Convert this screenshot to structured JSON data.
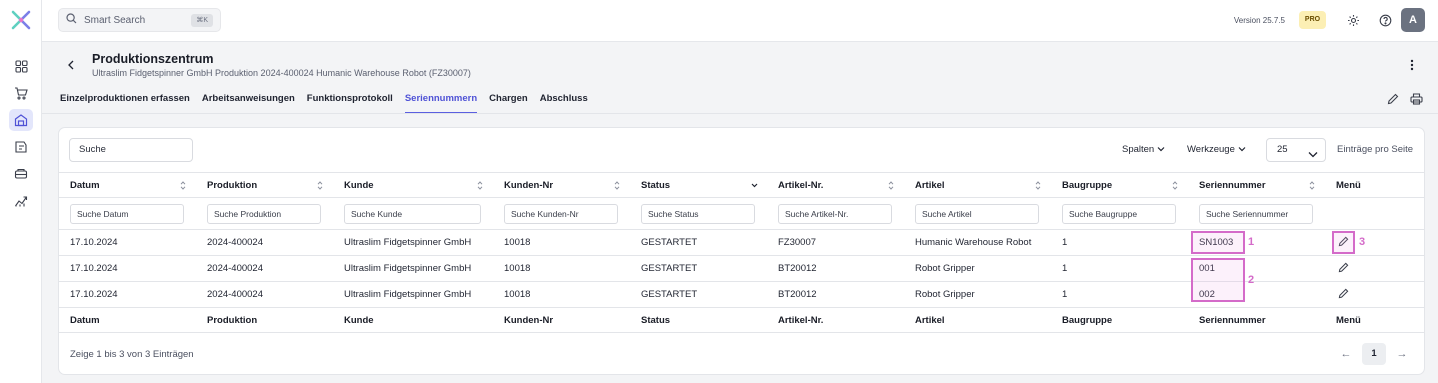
{
  "topbar": {
    "search_placeholder": "Smart Search",
    "search_shortcut": "⌘K",
    "version": "Version 25.7.5",
    "plan_badge": "PRO",
    "avatar_initial": "A"
  },
  "rail": {
    "items": [
      "dashboard-icon",
      "cart-icon",
      "warehouse-icon",
      "purchase-icon",
      "production-icon",
      "analytics-icon"
    ],
    "active_item": "warehouse-icon"
  },
  "page": {
    "title": "Produktionszentrum",
    "subtitle": "Ultraslim Fidgetspinner GmbH Produktion 2024-400024 Humanic Warehouse Robot (FZ30007)"
  },
  "tabs": [
    {
      "label": "Einzelproduktionen erfassen",
      "active": false
    },
    {
      "label": "Arbeitsanweisungen",
      "active": false
    },
    {
      "label": "Funktionsprotokoll",
      "active": false
    },
    {
      "label": "Seriennummern",
      "active": true
    },
    {
      "label": "Chargen",
      "active": false
    },
    {
      "label": "Abschluss",
      "active": false
    }
  ],
  "toolbar": {
    "search_value": "Suche",
    "columns_label": "Spalten",
    "tools_label": "Werkzeuge",
    "page_size": "25",
    "per_page_label": "Einträge pro Seite"
  },
  "table": {
    "columns": [
      "Datum",
      "Produktion",
      "Kunde",
      "Kunden-Nr",
      "Status",
      "Artikel-Nr.",
      "Artikel",
      "Baugruppe",
      "Seriennummer",
      "Menü"
    ],
    "filters": [
      "Suche Datum",
      "Suche Produktion",
      "Suche Kunde",
      "Suche Kunden-Nr",
      "Suche Status",
      "Suche Artikel-Nr.",
      "Suche Artikel",
      "Suche Baugruppe",
      "Suche Seriennummer"
    ],
    "rows": [
      [
        "17.10.2024",
        "2024-400024",
        "Ultraslim Fidgetspinner GmbH",
        "10018",
        "GESTARTET",
        "FZ30007",
        "Humanic Warehouse Robot",
        "1",
        "SN1003"
      ],
      [
        "17.10.2024",
        "2024-400024",
        "Ultraslim Fidgetspinner GmbH",
        "10018",
        "GESTARTET",
        "BT20012",
        "Robot Gripper",
        "1",
        "001"
      ],
      [
        "17.10.2024",
        "2024-400024",
        "Ultraslim Fidgetspinner GmbH",
        "10018",
        "GESTARTET",
        "BT20012",
        "Robot Gripper",
        "1",
        "002"
      ]
    ]
  },
  "annotations": {
    "mark1": "1",
    "mark2": "2",
    "mark3": "3",
    "color": "#d46bc9"
  },
  "footer": {
    "info": "Zeige 1 bis 3 von 3 Einträgen",
    "current_page": "1",
    "prev": "←",
    "next": "→"
  },
  "colors": {
    "accent": "#5b5fe0",
    "pro_badge": "#fcefb4",
    "active_rail": "#e3e6fb"
  }
}
